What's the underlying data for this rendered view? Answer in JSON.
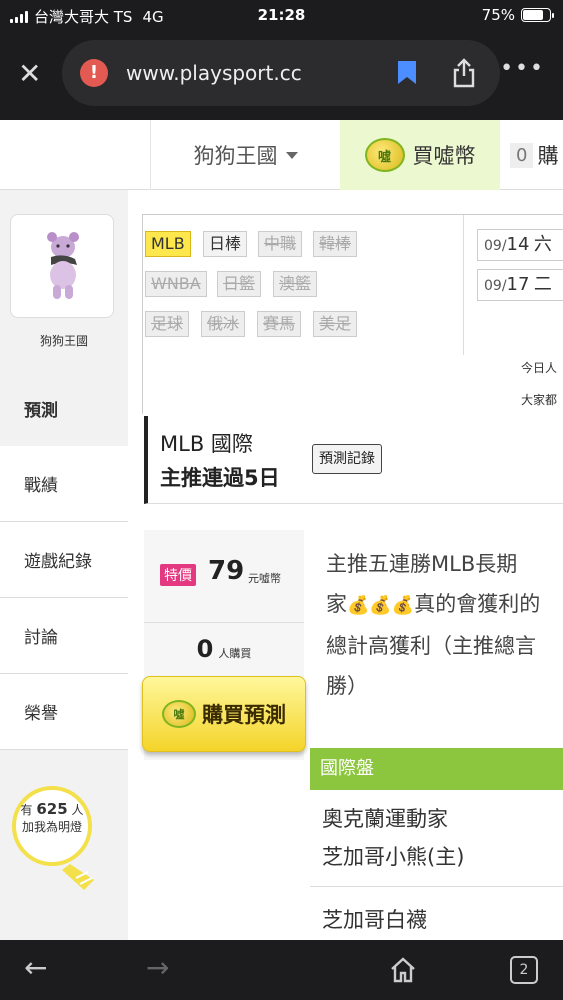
{
  "status_bar": {
    "carrier": "台灣大哥大 TS",
    "network": "4G",
    "time": "21:28",
    "battery": "75%",
    "battery_level": 0.75
  },
  "browser": {
    "url": "www.playsport.cc",
    "tab_count": "2"
  },
  "header": {
    "username": "狗狗王國",
    "buy_coin_label": "買噓幣",
    "coin_glyph": "噓",
    "cart_count": "0",
    "cart_label": "購"
  },
  "sidebar": {
    "username": "狗狗王國",
    "menu": [
      "預測",
      "戰績",
      "遊戲紀錄",
      "討論",
      "榮譽"
    ],
    "lamp": {
      "prefix": "有",
      "count": "625",
      "suffix": "人",
      "caption": "加我為明燈"
    }
  },
  "filters": {
    "leagues": [
      {
        "label": "MLB",
        "state": "active"
      },
      {
        "label": "日棒",
        "state": "enabled"
      },
      {
        "label": "中職",
        "state": "disabled"
      },
      {
        "label": "韓棒",
        "state": "disabled"
      },
      {
        "label": "WNBA",
        "state": "disabled"
      },
      {
        "label": "日籃",
        "state": "disabled"
      },
      {
        "label": "澳籃",
        "state": "disabled"
      },
      {
        "label": "足球",
        "state": "disabled"
      },
      {
        "label": "俄冰",
        "state": "disabled"
      },
      {
        "label": "賽馬",
        "state": "disabled"
      },
      {
        "label": "美足",
        "state": "disabled"
      }
    ],
    "dates": [
      {
        "month": "09/",
        "day": "14",
        "weekday": "六"
      },
      {
        "month": "09/",
        "day": "17",
        "weekday": "二"
      }
    ],
    "info_1": "今日人",
    "info_2": "大家都"
  },
  "prediction": {
    "league_title": "MLB 國際",
    "streak": "主推連過5日",
    "record_button": "預測記錄",
    "sale_badge": "特價",
    "price": "79",
    "price_unit": "元噓幣",
    "buyers_count": "0",
    "buyers_label": "人購買",
    "buy_button": "購買預測",
    "description": {
      "line1": "主推五連勝MLB長期",
      "line2_prefix": "家",
      "line2_suffix": "真的會獲利的",
      "line3": "總計高獲利（主推總言",
      "line4": "勝）"
    },
    "market_title": "國際盤",
    "teams": [
      "奧克蘭運動家",
      "芝加哥小熊(主)",
      "芝加哥白襪"
    ]
  }
}
